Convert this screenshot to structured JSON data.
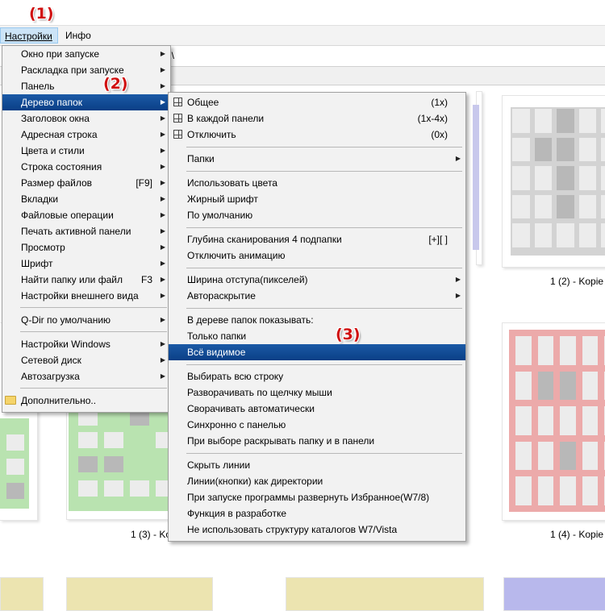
{
  "menubar": {
    "settings": "Настройки",
    "info": "Инфо"
  },
  "address": {
    "path_fragment": "2\\"
  },
  "callouts": {
    "c1": "(1)",
    "c2": "(2)",
    "c3": "(3)"
  },
  "settings_menu": {
    "items": [
      "Окно при запуске",
      "Раскладка при запуске",
      "Панель",
      "Дерево папок",
      "Заголовок окна",
      "Адресная строка",
      "Цвета и стили",
      "Строка состояния",
      "Размер файлов",
      "Вкладки",
      "Файловые операции",
      "Печать активной панели",
      "Просмотр",
      "Шрифт",
      "Найти папку или файл",
      "Настройки внешнего вида",
      "Q-Dir по умолчанию",
      "Настройки Windows",
      "Сетевой диск",
      "Автозагрузка",
      "Дополнительно.."
    ],
    "shortcut_file_size": "[F9]",
    "shortcut_find": "F3"
  },
  "tree_menu": {
    "items": [
      "Общее",
      "В каждой панели",
      "Отключить",
      "Папки",
      "Использовать цвета",
      "Жирный шрифт",
      "По умолчанию",
      "Глубина сканирования 4 подпапки",
      "Отключить анимацию",
      "Ширина отступа(пикселей)",
      "Автораскрытие",
      "В дереве папок показывать:",
      "Только папки",
      "Всё видимое",
      "Выбирать всю строку",
      "Разворачивать по щелчку мыши",
      "Сворачивать автоматически",
      "Синхронно с панелью",
      "При выборе раскрывать папку и в панели",
      "Скрыть линии",
      "Линии(кнопки) как директории",
      "При запуске программы развернуть Избранное(W7/8)",
      "Функция в разработке",
      "Не использовать структуру каталогов W7/Vista"
    ],
    "shortcuts": {
      "general": "(1x)",
      "each_panel": "(1x-4x)",
      "disable": "(0x)",
      "depth": "[+][ ]"
    }
  },
  "thumbnails": {
    "captions": [
      "1 (2) - Kopie",
      "1 (3) - Kopie",
      "1 (4) - Kopie"
    ],
    "colors": {
      "gray": "#c8c8c8",
      "green": "#b9e3b0",
      "red": "#ecaaaa",
      "yellow": "#ece4b0",
      "purple": "#b8b8ec"
    }
  }
}
